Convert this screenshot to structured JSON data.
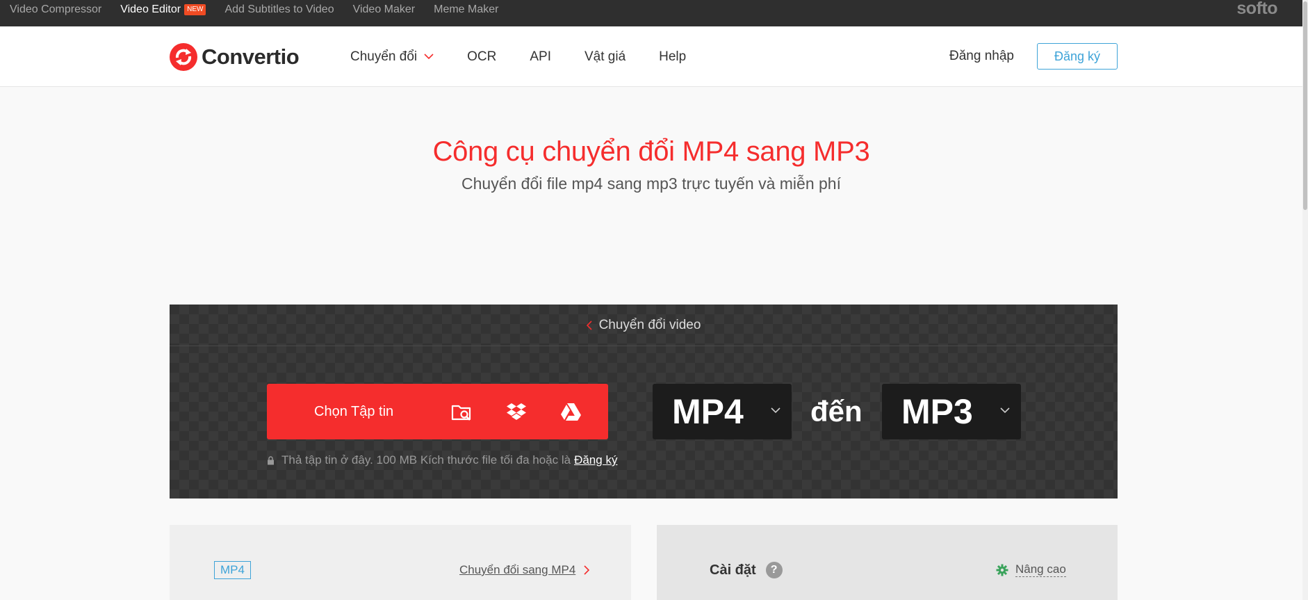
{
  "topbar": {
    "links": [
      {
        "label": "Video Compressor",
        "active": false
      },
      {
        "label": "Video Editor",
        "active": true,
        "badge": "NEW"
      },
      {
        "label": "Add Subtitles to Video",
        "active": false
      },
      {
        "label": "Video Maker",
        "active": false
      },
      {
        "label": "Meme Maker",
        "active": false
      }
    ],
    "brand": "softo"
  },
  "header": {
    "logo_text": "Convertio",
    "nav": [
      "Chuyển đổi",
      "OCR",
      "API",
      "Vật giá",
      "Help"
    ],
    "login": "Đăng nhập",
    "signup": "Đăng ký"
  },
  "hero": {
    "title": "Công cụ chuyển đổi MP4 sang MP3",
    "subtitle": "Chuyển đổi file mp4 sang mp3 trực tuyến và miễn phí"
  },
  "converter": {
    "back_link": "Chuyển đổi video",
    "choose_label": "Chọn Tập tin",
    "drop_note": "Thả tập tin ở đây. 100 MB Kích thước file tối đa hoặc là",
    "drop_note_link": "Đăng ký",
    "from_format": "MP4",
    "to_word": "đến",
    "to_format": "MP3"
  },
  "panels": {
    "left_tag": "MP4",
    "left_link": "Chuyển đổi sang MP4",
    "settings_title": "Cài đặt",
    "settings_help": "?",
    "advanced": "Nâng cao"
  },
  "colors": {
    "brand_red": "#f52d2d",
    "accent_blue": "#3da3d8",
    "topbar_bg": "#2f2f2f",
    "advanced_icon_green": "#3aa35b"
  },
  "icons": [
    "folder-search-icon",
    "dropbox-icon",
    "google-drive-icon",
    "lock-icon",
    "gear-icon",
    "chevron-down-icon",
    "chevron-left-icon",
    "chevron-right-icon"
  ]
}
